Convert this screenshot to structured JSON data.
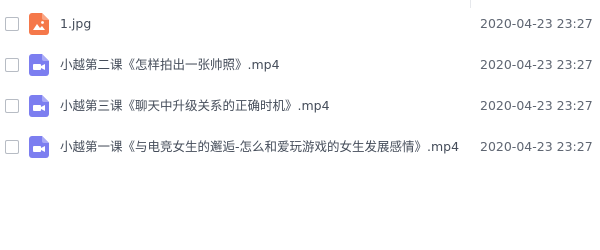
{
  "files": [
    {
      "name": "1.jpg",
      "date": "2020-04-23 23:27",
      "icon": "image-file-icon",
      "icon_color": "#f5784a"
    },
    {
      "name": "小越第二课《怎样拍出一张帅照》.mp4",
      "date": "2020-04-23 23:27",
      "icon": "video-file-icon",
      "icon_color": "#7c7ef0"
    },
    {
      "name": "小越第三课《聊天中升级关系的正确时机》.mp4",
      "date": "2020-04-23 23:27",
      "icon": "video-file-icon",
      "icon_color": "#7c7ef0"
    },
    {
      "name": "小越第一课《与电竞女生的邂逅-怎么和爱玩游戏的女生发展感情》.mp4",
      "date": "2020-04-23 23:27",
      "icon": "video-file-icon",
      "icon_color": "#7c7ef0"
    }
  ]
}
